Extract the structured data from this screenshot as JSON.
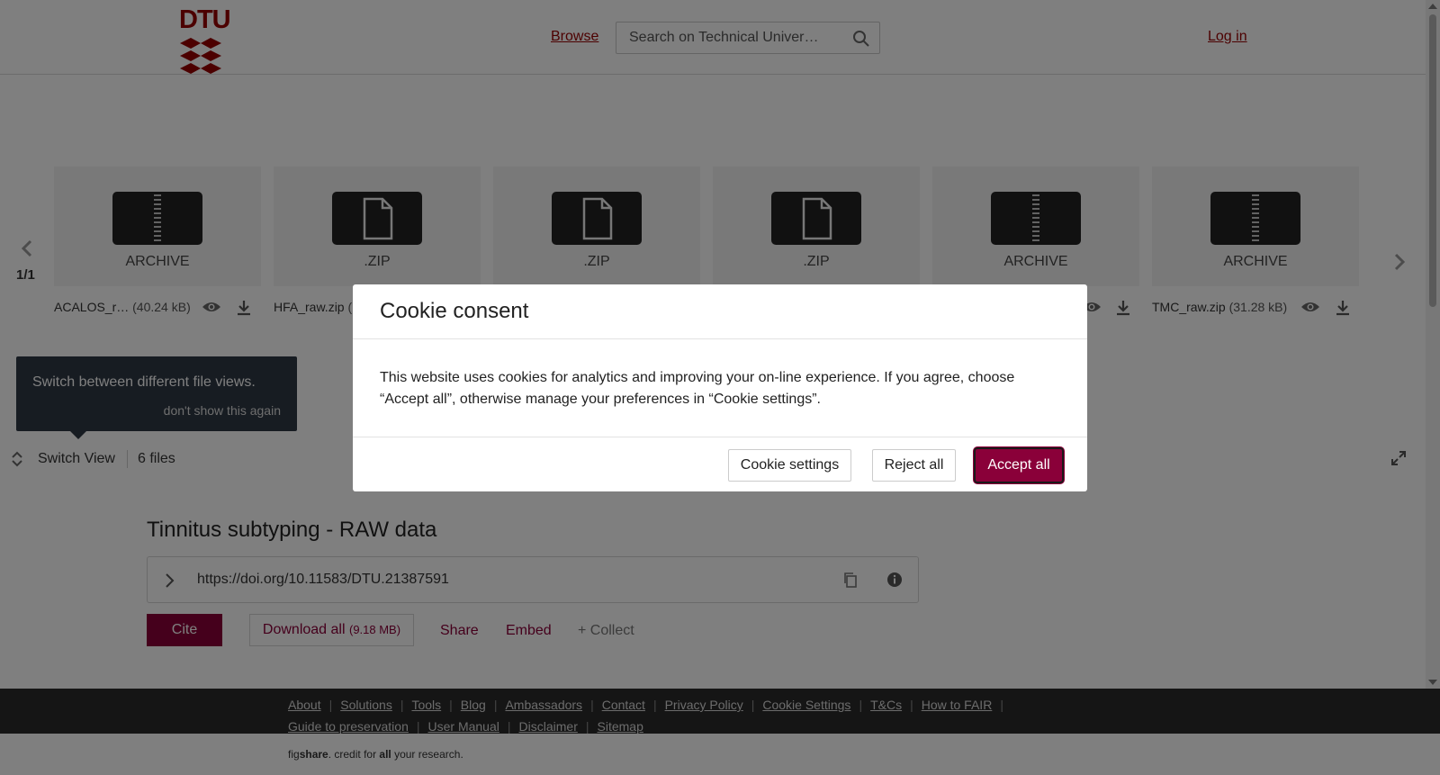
{
  "header": {
    "logo_text": "DTU",
    "browse_label": "Browse",
    "search_placeholder": "Search on Technical Univer…",
    "login_label": "Log in"
  },
  "carousel": {
    "page_indicator": "1/1",
    "files": [
      {
        "type_label": "ARCHIVE",
        "icon": "archive-icon",
        "name": "ACALOS_r…",
        "size": "(40.24 kB)"
      },
      {
        "type_label": ".ZIP",
        "icon": "file-icon",
        "name": "HFA_raw.zip",
        "size": "("
      },
      {
        "type_label": ".ZIP",
        "icon": "file-icon",
        "name": "",
        "size": ""
      },
      {
        "type_label": ".ZIP",
        "icon": "file-icon",
        "name": "",
        "size": ""
      },
      {
        "type_label": "ARCHIVE",
        "icon": "archive-icon",
        "name": "",
        "size": ""
      },
      {
        "type_label": "ARCHIVE",
        "icon": "archive-icon",
        "name": "TMC_raw.zip",
        "size": "(31.28 kB)"
      }
    ]
  },
  "tooltip": {
    "text": "Switch between different file views.",
    "dismiss": "don't show this again"
  },
  "file_view": {
    "switch_label": "Switch View",
    "files_count": "6 files"
  },
  "item": {
    "title": "Tinnitus subtyping - RAW data",
    "doi": "https://doi.org/10.11583/DTU.21387591",
    "cite_label": "Cite",
    "download_label": "Download all",
    "download_size": "(9.18 MB)",
    "share_label": "Share",
    "embed_label": "Embed",
    "collect_label": "+ Collect"
  },
  "footer": {
    "links_row1": [
      "About",
      "Solutions",
      "Tools",
      "Blog",
      "Ambassadors",
      "Contact",
      "Privacy Policy",
      "Cookie Settings",
      "T&Cs",
      "How to FAIR"
    ],
    "links_row2": [
      "Guide to preservation",
      "User Manual",
      "Disclaimer",
      "Sitemap"
    ],
    "tagline_fig": "fig",
    "tagline_share": "share",
    "tagline_mid": ". credit for ",
    "tagline_all": "all",
    "tagline_end": " your research."
  },
  "cookie_modal": {
    "title": "Cookie consent",
    "body": "This website uses cookies for analytics and improving your on-line experience. If you agree, choose “Accept all”, otherwise manage your preferences in “Cookie settings”.",
    "settings_label": "Cookie settings",
    "reject_label": "Reject all",
    "accept_label": "Accept all"
  },
  "colors": {
    "brand": "#990000",
    "accent": "#8a0039",
    "footer_bg": "#2a2a2a"
  }
}
